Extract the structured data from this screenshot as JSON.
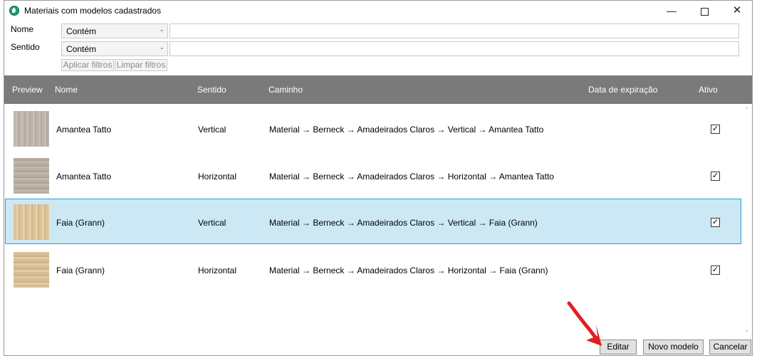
{
  "window": {
    "title": "Materiais com modelos cadastrados",
    "controls": {
      "minimize": "—",
      "maximize": "",
      "close": "✕"
    }
  },
  "filters": {
    "nome": {
      "label": "Nome",
      "operator": "Contém",
      "value": ""
    },
    "sentido": {
      "label": "Sentido",
      "operator": "Contém",
      "value": ""
    },
    "apply_label": "Aplicar filtros",
    "clear_label": "Limpar filtros"
  },
  "grid": {
    "columns": [
      "Preview",
      "Nome",
      "Sentido",
      "Caminho",
      "Data de expiração",
      "Ativo"
    ],
    "rows": [
      {
        "nome": "Amantea Tatto",
        "sentido": "Vertical",
        "caminho": "Material → Berneck → Amadeirados Claros → Vertical → Amantea Tatto",
        "data": "",
        "ativo": "✓",
        "swatch": "#bdb5ab"
      },
      {
        "nome": "Amantea Tatto",
        "sentido": "Horizontal",
        "caminho": "Material → Berneck → Amadeirados Claros → Horizontal → Amantea Tatto",
        "data": "",
        "ativo": "✓",
        "swatch": "#b8aea4"
      },
      {
        "nome": "Faia (Grann)",
        "sentido": "Vertical",
        "caminho": "Material → Berneck → Amadeirados Claros → Vertical → Faia (Grann)",
        "data": "",
        "ativo": "✓",
        "swatch": "#dcc39a"
      },
      {
        "nome": "Faia (Grann)",
        "sentido": "Horizontal",
        "caminho": "Material → Berneck → Amadeirados Claros → Horizontal → Faia (Grann)",
        "data": "",
        "ativo": "✓",
        "swatch": "#d8bd95"
      }
    ],
    "selected_row": 3
  },
  "buttons": {
    "edit": "Editar",
    "new_model": "Novo modelo",
    "cancel": "Cancelar"
  },
  "colors": {
    "header_bg": "#7a7a7a",
    "selection_bg": "#cce8f4",
    "selection_border": "#26a0da",
    "annotation_arrow": "#e02020"
  },
  "icons": {
    "app": "app-logo-icon",
    "arrow": "red-annotation-arrow-icon"
  }
}
